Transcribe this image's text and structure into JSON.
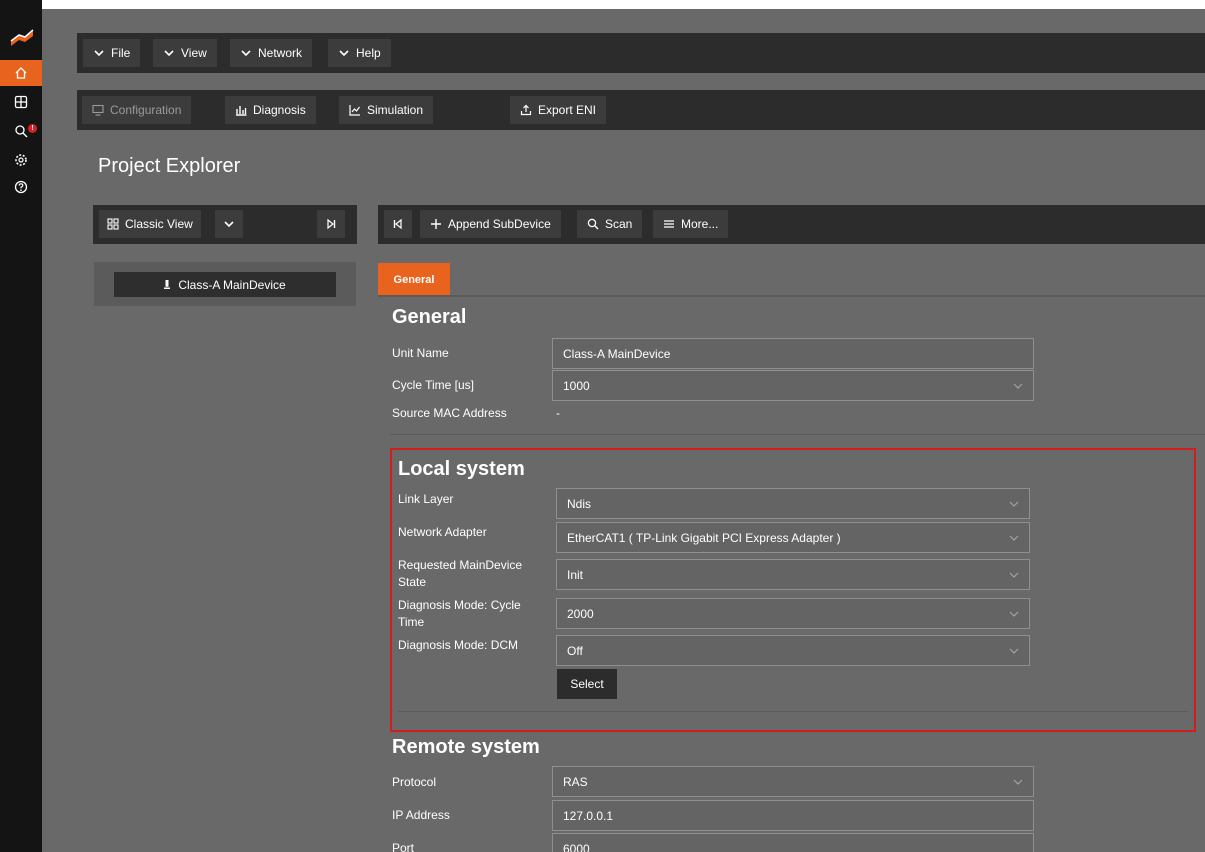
{
  "menu": {
    "items": [
      {
        "label": "File"
      },
      {
        "label": "View"
      },
      {
        "label": "Network"
      },
      {
        "label": "Help"
      }
    ]
  },
  "toolbar": {
    "configuration": "Configuration",
    "diagnosis": "Diagnosis",
    "simulation": "Simulation",
    "export_eni": "Export ENI"
  },
  "page": {
    "title": "Project Explorer"
  },
  "explorer": {
    "view_label": "Classic View",
    "tree_item": "Class-A MainDevice"
  },
  "actions": {
    "append": "Append SubDevice",
    "scan": "Scan",
    "more": "More..."
  },
  "tabs": {
    "general": "General"
  },
  "general": {
    "heading": "General",
    "unit_name_label": "Unit Name",
    "unit_name_value": "Class-A MainDevice",
    "cycle_time_label": "Cycle Time [us]",
    "cycle_time_value": "1000",
    "mac_label": "Source MAC Address",
    "mac_value": "-"
  },
  "local": {
    "heading": "Local system",
    "link_layer_label": "Link Layer",
    "link_layer_value": "Ndis",
    "adapter_label": "Network Adapter",
    "adapter_value": "EtherCAT1 ( TP-Link Gigabit PCI Express Adapter )",
    "state_label_1": "Requested MainDevice",
    "state_label_2": "State",
    "state_value": "Init",
    "diag_cycle_label_1": "Diagnosis Mode: Cycle",
    "diag_cycle_label_2": "Time",
    "diag_cycle_value": "2000",
    "diag_dcm_label": "Diagnosis Mode: DCM",
    "diag_dcm_value": "Off",
    "select_button": "Select"
  },
  "remote": {
    "heading": "Remote system",
    "protocol_label": "Protocol",
    "protocol_value": "RAS",
    "ip_label": "IP Address",
    "ip_value": "127.0.0.1",
    "port_label": "Port",
    "port_value": "6000"
  },
  "colors": {
    "accent": "#e8641e",
    "highlight_border": "#d11d1d",
    "rail": "#141414",
    "panel": "#696969"
  },
  "icons": {
    "logo": "app-logo-icon",
    "home": "home-icon",
    "grid": "grid-icon",
    "diagnose": "diagnose-icon",
    "settings": "gear-icon",
    "help": "help-icon"
  }
}
